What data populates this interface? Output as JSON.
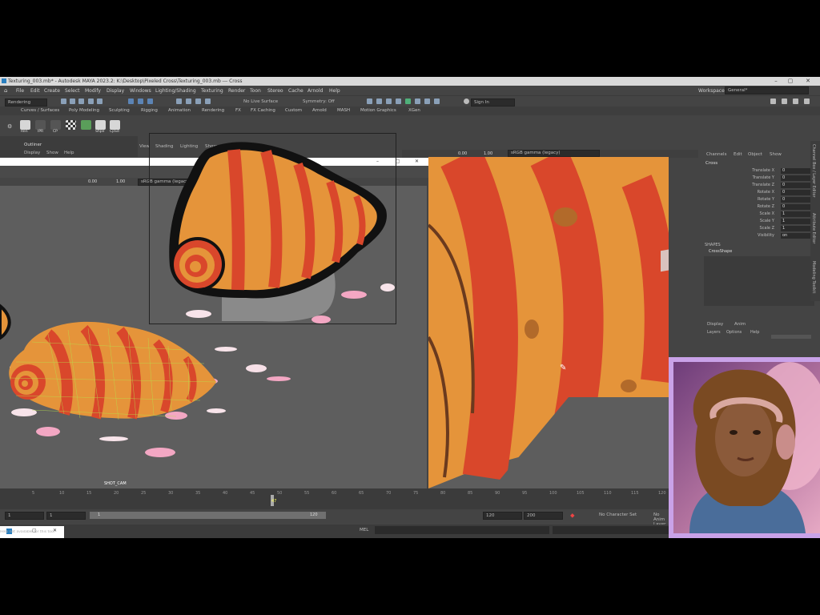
{
  "window": {
    "title": "Texturing_003.mb* - Autodesk MAYA 2023.2: K:\\Desktop\\Pixeled Cross\\Texturing_003.mb --- Cross"
  },
  "menu": {
    "items": [
      "File",
      "Edit",
      "Create",
      "Select",
      "Modify",
      "Display",
      "Windows",
      "Lighting/Shading",
      "Texturing",
      "Render",
      "Toon",
      "Stereo",
      "Cache",
      "Arnold",
      "Help"
    ],
    "workspace_label": "Workspace:",
    "workspace_value": "General*"
  },
  "statusline": {
    "mode": "Rendering",
    "live_surface": "No Live Surface",
    "symmetry": "Symmetry: Off",
    "sign_in": "Sign In"
  },
  "shelf": {
    "tabs": [
      "Curves / Surfaces",
      "Poly Modeling",
      "Sculpting",
      "Rigging",
      "Animation",
      "Rendering",
      "FX",
      "FX Caching",
      "Custom",
      "Arnold",
      "MASH",
      "Motion Graphics",
      "XGen"
    ],
    "icons": [
      {
        "name": "render-icon",
        "label": "Ren"
      },
      {
        "name": "ipr-icon",
        "label": "IPR"
      },
      {
        "name": "cp-icon",
        "label": "CP"
      },
      {
        "name": "checker-icon",
        "label": ""
      },
      {
        "name": "hypershade-icon",
        "label": "Shpe"
      },
      {
        "name": "cpsd-icon",
        "label": "CpSd"
      }
    ]
  },
  "outliner": {
    "title": "Outliner",
    "menu": [
      "Display",
      "Show",
      "Help"
    ]
  },
  "viewport_left": {
    "menu": [
      "View",
      "Shading",
      "Lighting",
      "Show"
    ],
    "field_a": "0.00",
    "field_b": "1.00",
    "colorspace": "sRGB gamma (legacy)",
    "camera_label": "SHOT_CAM"
  },
  "viewport_right": {
    "field_a": "0.00",
    "field_b": "1.00",
    "colorspace": "sRGB gamma (legacy)"
  },
  "channel_box": {
    "tabs": [
      "Channels",
      "Edit",
      "Object",
      "Show"
    ],
    "object_name": "Cross",
    "channels": [
      {
        "label": "Translate X",
        "value": "0"
      },
      {
        "label": "Translate Y",
        "value": "0"
      },
      {
        "label": "Translate Z",
        "value": "0"
      },
      {
        "label": "Rotate X",
        "value": "0"
      },
      {
        "label": "Rotate Y",
        "value": "0"
      },
      {
        "label": "Rotate Z",
        "value": "0"
      },
      {
        "label": "Scale X",
        "value": "1"
      },
      {
        "label": "Scale Y",
        "value": "1"
      },
      {
        "label": "Scale Z",
        "value": "1"
      },
      {
        "label": "Visibility",
        "value": "on"
      }
    ],
    "shapes_header": "SHAPES",
    "shape_name": "CrossShape",
    "layer_tabs": [
      "Display",
      "Anim"
    ],
    "layer_menu": [
      "Layers",
      "Options",
      "Help"
    ]
  },
  "right_tabs": [
    "Channel Box / Layer Editor",
    "Attribute Editor",
    "Modeling Toolkit"
  ],
  "timeline": {
    "ticks": [
      "5",
      "10",
      "15",
      "20",
      "25",
      "30",
      "35",
      "40",
      "45",
      "50",
      "55",
      "60",
      "65",
      "70",
      "75",
      "80",
      "85",
      "90",
      "95",
      "100",
      "105",
      "110",
      "115",
      "120"
    ],
    "current_frame": "47"
  },
  "range": {
    "start": "1",
    "inner_start": "1",
    "range_field": "1",
    "range_end": "120",
    "end": "120",
    "anim_end": "200",
    "character_set": "No Character Set",
    "anim_layer": "No Anim Layer"
  },
  "cmdline": {
    "mel": "MEL",
    "help": "Help not available for this tool"
  },
  "colors": {
    "maya_bg": "#444444",
    "viewport_bg": "#5e5e5e",
    "shell_orange": "#e5943a",
    "shell_red": "#d9472b",
    "webcam_border": "#c9a2e8"
  }
}
